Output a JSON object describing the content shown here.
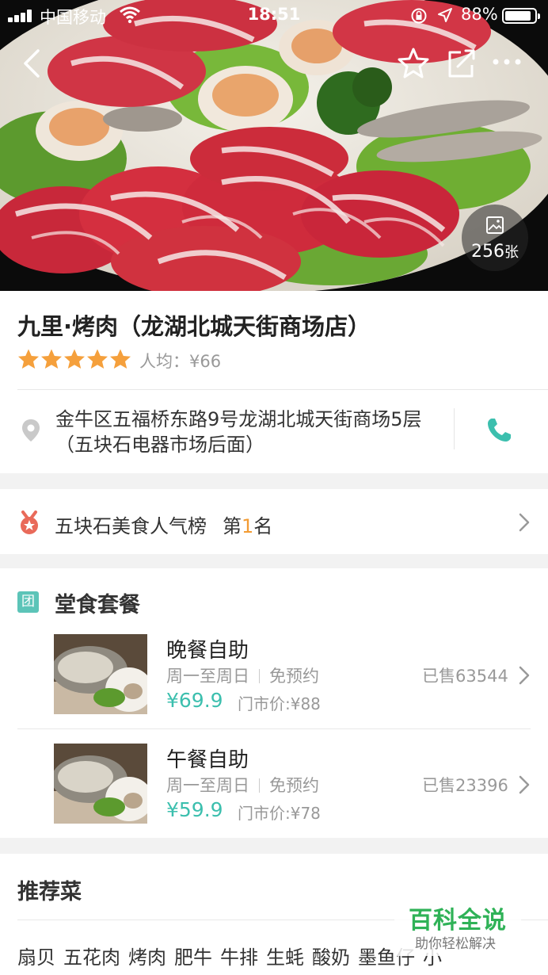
{
  "status_bar": {
    "carrier": "中国移动",
    "time": "18:51",
    "battery": "88%",
    "battery_level": 0.88
  },
  "hero": {
    "photo_count": "256",
    "photo_unit": "张"
  },
  "shop": {
    "name": "九里·烤肉（龙湖北城天街商场店）",
    "rating_stars": 5,
    "avg_price": "人均：¥66",
    "address_line1": "金牛区五福桥东路9号龙湖北城天街商场5层",
    "address_line2": "（五块石电器市场后面）"
  },
  "ranking": {
    "list_name": "五块石美食人气榜",
    "prefix": "第",
    "rank": "1",
    "suffix": "名"
  },
  "packages": {
    "badge": "团",
    "title": "堂食套餐",
    "deals": [
      {
        "name": "晚餐自助",
        "days": "周一至周日",
        "reservation": "免预约",
        "price": "¥69.9",
        "original": "门市价:¥88",
        "sold": "已售63544"
      },
      {
        "name": "午餐自助",
        "days": "周一至周日",
        "reservation": "免预约",
        "price": "¥59.9",
        "original": "门市价:¥78",
        "sold": "已售23396"
      }
    ]
  },
  "recommend": {
    "title": "推荐菜",
    "dishes": [
      "扇贝",
      "五花肉",
      "烤肉",
      "肥牛",
      "牛排",
      "生蚝",
      "酸奶",
      "墨鱼仔",
      "小"
    ]
  },
  "watermark": {
    "main": "百科全说",
    "sub": "助你轻松解决"
  },
  "colors": {
    "accent": "#3cbfae",
    "star": "#f5a03c",
    "rank_highlight": "#f39c34",
    "watermark": "#2fb257"
  }
}
